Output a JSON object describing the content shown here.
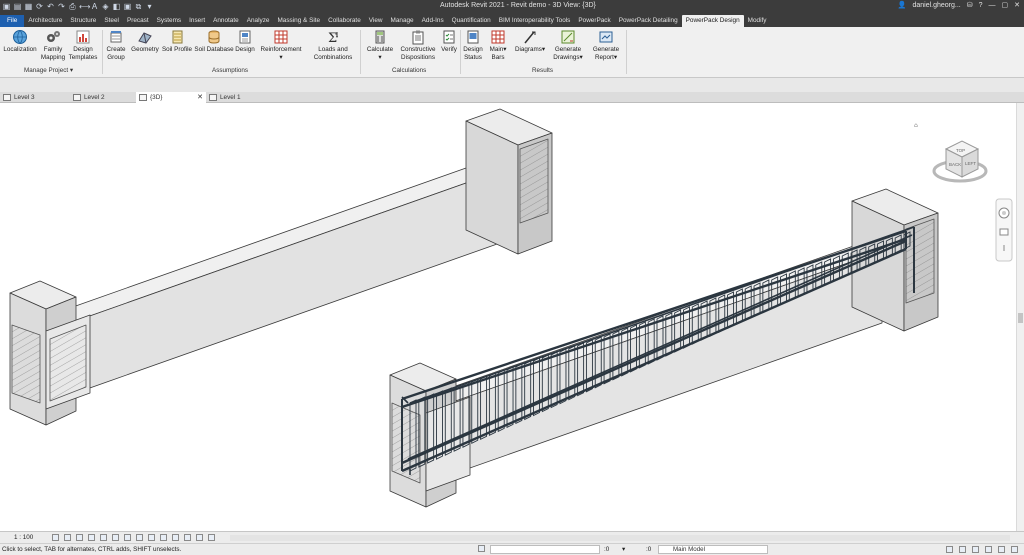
{
  "titlebar": {
    "title": "Autodesk Revit 2021 - Revit demo - 3D View: {3D}",
    "user": "daniel.gheorg...",
    "help": "?"
  },
  "ribbon_tabs": [
    "File",
    "Architecture",
    "Structure",
    "Steel",
    "Precast",
    "Systems",
    "Insert",
    "Annotate",
    "Analyze",
    "Massing & Site",
    "Collaborate",
    "View",
    "Manage",
    "Add-Ins",
    "Quantification",
    "BIM Interoperability Tools",
    "PowerPack",
    "PowerPack Detailing",
    "PowerPack Design",
    "Modify"
  ],
  "ribbon": {
    "manage_project": {
      "localization": "Localization",
      "family_mapping_1": "Family",
      "family_mapping_2": "Mapping",
      "design_templates_1": "Design",
      "design_templates_2": "Templates",
      "label": "Manage Project"
    },
    "assumptions": {
      "create_group_1": "Create",
      "create_group_2": "Group",
      "geometry": "Geometry",
      "soil_profile": "Soil Profile",
      "soil_database": "Soil Database",
      "design": "Design",
      "reinforcement": "Reinforcement",
      "loads_1": "Loads and",
      "loads_2": "Combinations",
      "label": "Assumptions"
    },
    "calculations": {
      "calculate": "Calculate",
      "constructive_1": "Constructive",
      "constructive_2": "Dispositions",
      "verify": "Verify",
      "label": "Calculations"
    },
    "results": {
      "design_status_1": "Design",
      "design_status_2": "Status",
      "main_bars_1": "Main",
      "main_bars_2": "Bars",
      "diagrams": "Diagrams",
      "gen_drawings_1": "Generate",
      "gen_drawings_2": "Drawings",
      "gen_report_1": "Generate",
      "gen_report_2": "Report",
      "label": "Results"
    }
  },
  "view_tabs": [
    "Level 3",
    "Level 2",
    "{3D}",
    "Level 1"
  ],
  "viewcube": {
    "top": "TOP",
    "back": "BACK",
    "left": "LEFT"
  },
  "view_control": {
    "scale": "1 : 100"
  },
  "status": {
    "message": "Click to select, TAB for alternates, CTRL adds, SHIFT unselects.",
    "zero1": ":0",
    "model": "Main Model",
    "zero2": ":0"
  },
  "colors": {
    "file_tab": "#1e60b0",
    "titlebar": "#3c3c3c",
    "rebar": "#2b3640"
  }
}
